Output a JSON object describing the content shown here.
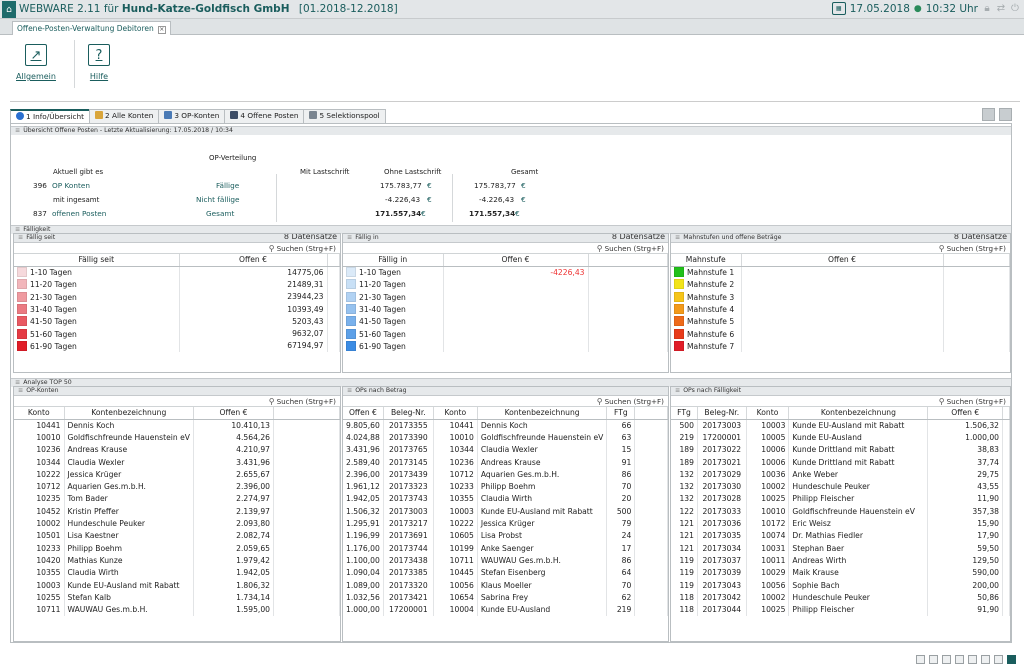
{
  "titlebar": {
    "app": "WEBWARE 2.11 für",
    "company": "Hund-Katze-Goldfisch GmbH",
    "range": "[01.2018-12.2018]",
    "date": "17.05.2018",
    "time": "10:32 Uhr",
    "calendar_icon": "calendar-icon",
    "accent": "#1a5d5d"
  },
  "doc_tab": {
    "label": "Offene-Posten-Verwaltung Debitoren"
  },
  "ribbon": {
    "allgemein": "Allgemein",
    "hilfe": "Hilfe"
  },
  "tabs": [
    {
      "label": "1 Info/Übersicht"
    },
    {
      "label": "2 Alle Konten"
    },
    {
      "label": "3 OP-Konten"
    },
    {
      "label": "4 Offene Posten"
    },
    {
      "label": "5 Selektionspool"
    }
  ],
  "overview": {
    "header": "Übersicht Offene Posten - Letzte Aktualisierung: 17.05.2018 / 10:34",
    "op_verteilung": "OP-Verteilung",
    "aktuell": "Aktuell gibt es",
    "mit_lastschrift": "Mit Lastschrift",
    "ohne_lastschrift": "Ohne Lastschrift",
    "gesamt_col": "Gesamt",
    "n_konten": "396",
    "op_konten": "OP Konten",
    "faellige": "Fällige",
    "mit_ingesamt": "mit ingesamt",
    "nicht_faellige": "Nicht fällige",
    "n_posten": "837",
    "offenen_posten": "offenen Posten",
    "gesamt_row": "Gesamt",
    "ohne": [
      "175.783,77",
      "-4.226,43",
      "171.557,34"
    ],
    "ges": [
      "175.783,77",
      "-4.226,43",
      "171.557,34"
    ],
    "currency": "€"
  },
  "faelligkeit": {
    "header": "Fälligkeit",
    "search": "Suchen (Strg+F)",
    "count": "8 Datensätze",
    "faellig_seit": {
      "title": "Fällig seit",
      "col1": "Fällig seit",
      "col2": "Offen €",
      "rows": [
        {
          "label": "1-10 Tagen",
          "value": "14775,06",
          "color": "#f6d9dc"
        },
        {
          "label": "11-20 Tagen",
          "value": "21489,31",
          "color": "#f2b6bb"
        },
        {
          "label": "21-30 Tagen",
          "value": "23944,23",
          "color": "#ef9aa0"
        },
        {
          "label": "31-40 Tagen",
          "value": "10393,49",
          "color": "#eb7a82"
        },
        {
          "label": "41-50 Tagen",
          "value": "5203,43",
          "color": "#e95a63"
        },
        {
          "label": "51-60 Tagen",
          "value": "9632,07",
          "color": "#e53a44"
        },
        {
          "label": "61-90 Tagen",
          "value": "67194,97",
          "color": "#e11d28"
        }
      ]
    },
    "faellig_in": {
      "title": "Fällig in",
      "col1": "Fällig in",
      "col2": "Offen €",
      "rows": [
        {
          "label": "1-10 Tagen",
          "value": "-4226,43",
          "color": "#dbeaf8"
        },
        {
          "label": "11-20 Tagen",
          "value": "",
          "color": "#c8e0f6"
        },
        {
          "label": "21-30 Tagen",
          "value": "",
          "color": "#b1d2f3"
        },
        {
          "label": "31-40 Tagen",
          "value": "",
          "color": "#96c2ef"
        },
        {
          "label": "41-50 Tagen",
          "value": "",
          "color": "#79b1ec"
        },
        {
          "label": "51-60 Tagen",
          "value": "",
          "color": "#5ca0e8"
        },
        {
          "label": "61-90 Tagen",
          "value": "",
          "color": "#3b8ce4"
        }
      ]
    },
    "mahnstufen": {
      "title": "Mahnstufen und offene Beträge",
      "col1": "Mahnstufe",
      "col2": "Offen €",
      "rows": [
        {
          "label": "Mahnstufe 1",
          "value": "",
          "color": "#22c11a"
        },
        {
          "label": "Mahnstufe 2",
          "value": "",
          "color": "#f2e41a"
        },
        {
          "label": "Mahnstufe 3",
          "value": "",
          "color": "#f6c51a"
        },
        {
          "label": "Mahnstufe 4",
          "value": "",
          "color": "#f39a1a"
        },
        {
          "label": "Mahnstufe 5",
          "value": "",
          "color": "#ee6a1a"
        },
        {
          "label": "Mahnstufe 6",
          "value": "",
          "color": "#e83b1a"
        },
        {
          "label": "Mahnstufe 7",
          "value": "",
          "color": "#e11d28"
        }
      ]
    }
  },
  "analyse": {
    "header": "Analyse TOP 50",
    "search": "Suchen (Strg+F)",
    "op_konten": {
      "title": "OP-Konten",
      "cols": [
        "Konto",
        "Kontenbezeichnung",
        "Offen €"
      ],
      "rows": [
        [
          "10441",
          "Dennis Koch",
          "10.410,13"
        ],
        [
          "10010",
          "Goldfischfreunde Hauenstein eV",
          "4.564,26"
        ],
        [
          "10236",
          "Andreas Krause",
          "4.210,97"
        ],
        [
          "10344",
          "Claudia Wexler",
          "3.431,96"
        ],
        [
          "10222",
          "Jessica Krüger",
          "2.655,67"
        ],
        [
          "10712",
          "Aquarien Ges.m.b.H.",
          "2.396,00"
        ],
        [
          "10235",
          "Tom Bader",
          "2.274,97"
        ],
        [
          "10452",
          "Kristin Pfeffer",
          "2.139,97"
        ],
        [
          "10002",
          "Hundeschule Peuker",
          "2.093,80"
        ],
        [
          "10501",
          "Lisa Kaestner",
          "2.082,74"
        ],
        [
          "10233",
          "Philipp Boehm",
          "2.059,65"
        ],
        [
          "10420",
          "Mathias Kunze",
          "1.979,42"
        ],
        [
          "10355",
          "Claudia Wirth",
          "1.942,05"
        ],
        [
          "10003",
          "Kunde EU-Ausland mit Rabatt",
          "1.806,32"
        ],
        [
          "10255",
          "Stefan Kalb",
          "1.734,14"
        ],
        [
          "10711",
          "WAUWAU Ges.m.b.H.",
          "1.595,00"
        ]
      ]
    },
    "ops_betrag": {
      "title": "OPs nach Betrag",
      "cols": [
        "Offen €",
        "Beleg-Nr.",
        "Konto",
        "Kontenbezeichnung",
        "FTg"
      ],
      "rows": [
        [
          "9.805,60",
          "20173355",
          "10441",
          "Dennis Koch",
          "66"
        ],
        [
          "4.024,88",
          "20173390",
          "10010",
          "Goldfischfreunde Hauenstein eV",
          "63"
        ],
        [
          "3.431,96",
          "20173765",
          "10344",
          "Claudia Wexler",
          "15"
        ],
        [
          "2.589,40",
          "20173145",
          "10236",
          "Andreas Krause",
          "91"
        ],
        [
          "2.396,00",
          "20173439",
          "10712",
          "Aquarien Ges.m.b.H.",
          "86"
        ],
        [
          "1.961,12",
          "20173323",
          "10233",
          "Philipp Boehm",
          "70"
        ],
        [
          "1.942,05",
          "20173743",
          "10355",
          "Claudia Wirth",
          "20"
        ],
        [
          "1.506,32",
          "20173003",
          "10003",
          "Kunde EU-Ausland mit Rabatt",
          "500"
        ],
        [
          "1.295,91",
          "20173217",
          "10222",
          "Jessica Krüger",
          "79"
        ],
        [
          "1.196,99",
          "20173691",
          "10605",
          "Lisa Probst",
          "24"
        ],
        [
          "1.176,00",
          "20173744",
          "10199",
          "Anke Saenger",
          "17"
        ],
        [
          "1.100,00",
          "20173438",
          "10711",
          "WAUWAU Ges.m.b.H.",
          "86"
        ],
        [
          "1.090,04",
          "20173385",
          "10445",
          "Stefan Eisenberg",
          "64"
        ],
        [
          "1.089,00",
          "20173320",
          "10056",
          "Klaus Moeller",
          "70"
        ],
        [
          "1.032,56",
          "20173421",
          "10654",
          "Sabrina Frey",
          "62"
        ],
        [
          "1.000,00",
          "17200001",
          "10004",
          "Kunde EU-Ausland",
          "219"
        ]
      ]
    },
    "ops_faelligkeit": {
      "title": "OPs nach Fälligkeit",
      "cols": [
        "FTg",
        "Beleg-Nr.",
        "Konto",
        "Kontenbezeichnung",
        "Offen €"
      ],
      "rows": [
        [
          "500",
          "20173003",
          "10003",
          "Kunde EU-Ausland mit Rabatt",
          "1.506,32"
        ],
        [
          "219",
          "17200001",
          "10005",
          "Kunde EU-Ausland",
          "1.000,00"
        ],
        [
          "189",
          "20173022",
          "10006",
          "Kunde Drittland mit Rabatt",
          "38,83"
        ],
        [
          "189",
          "20173021",
          "10006",
          "Kunde Drittland mit Rabatt",
          "37,74"
        ],
        [
          "132",
          "20173029",
          "10036",
          "Anke Weber",
          "29,75"
        ],
        [
          "132",
          "20173030",
          "10002",
          "Hundeschule Peuker",
          "43,55"
        ],
        [
          "132",
          "20173028",
          "10025",
          "Philipp Fleischer",
          "11,90"
        ],
        [
          "122",
          "20173033",
          "10010",
          "Goldfischfreunde Hauenstein eV",
          "357,38"
        ],
        [
          "121",
          "20173036",
          "10172",
          "Eric Weisz",
          "15,90"
        ],
        [
          "121",
          "20173035",
          "10074",
          "Dr. Mathias Fiedler",
          "17,90"
        ],
        [
          "121",
          "20173034",
          "10031",
          "Stephan Baer",
          "59,50"
        ],
        [
          "119",
          "20173037",
          "10011",
          "Andreas Wirth",
          "129,50"
        ],
        [
          "119",
          "20173039",
          "10029",
          "Maik Krause",
          "590,00"
        ],
        [
          "119",
          "20173043",
          "10056",
          "Sophie Bach",
          "200,00"
        ],
        [
          "118",
          "20173042",
          "10002",
          "Hundeschule Peuker",
          "50,86"
        ],
        [
          "118",
          "20173044",
          "10025",
          "Philipp Fleischer",
          "91,90"
        ]
      ]
    }
  }
}
